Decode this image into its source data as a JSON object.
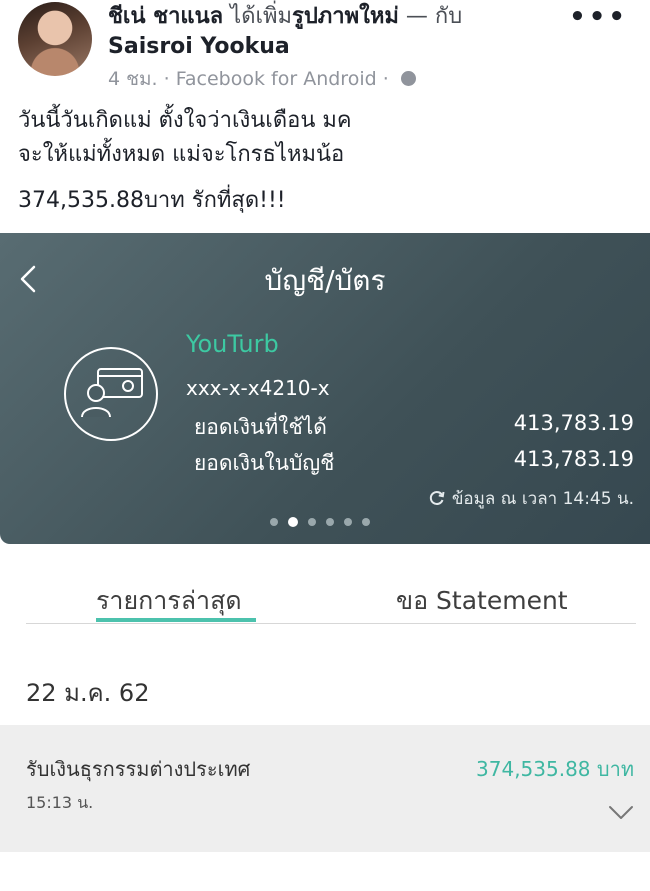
{
  "post": {
    "author": "ชีเน่ ชาแนล",
    "action": "ได้เพิ่ม",
    "object": "รูปภาพใหม่",
    "with_text": "— กับ",
    "tagged": "Saisroi Yookua",
    "time": "4 ชม.",
    "via": "· Facebook for Android ·",
    "text_line1": "วันนี้วันเกิดแม่ ตั้งใจว่าเงินเดือน มค",
    "text_line2": "จะให้แม่ทั้งหมด แม่จะโกรธไหมน้อ",
    "text_line3": "374,535.88บาท รักที่สุด!!!",
    "more_glyph": "•••",
    "icons": {
      "globe": "globe-icon",
      "more": "more-icon"
    }
  },
  "bank": {
    "title": "บัญชี/บัตร",
    "account_name": "YouTurb",
    "account_number": "xxx-x-x4210-x",
    "available_label": "ยอดเงินที่ใช้ได้",
    "available_value": "413,783.19",
    "balance_label": "ยอดเงินในบัญชี",
    "balance_value": "413,783.19",
    "updated_note": "ข้อมูล ณ เวลา 14:45 น.",
    "carousel": {
      "count": 6,
      "active_index": 1
    },
    "tabs": [
      {
        "label": "รายการล่าสุด",
        "active": true
      },
      {
        "label": "ขอ Statement",
        "active": false
      }
    ],
    "date_header": "22 ม.ค. 62",
    "transaction": {
      "description": "รับเงินธุรกรรมต่างประเทศ",
      "time": "15:13 น.",
      "amount": "374,535.88",
      "currency": "บาท"
    },
    "colors": {
      "panel": "#4a5c62",
      "accent": "#4cc2ad",
      "amount": "#3fb7a2"
    },
    "icons": {
      "back": "chevron-left-icon",
      "card": "card-user-icon",
      "refresh": "refresh-icon",
      "expand": "chevron-down-icon"
    }
  }
}
